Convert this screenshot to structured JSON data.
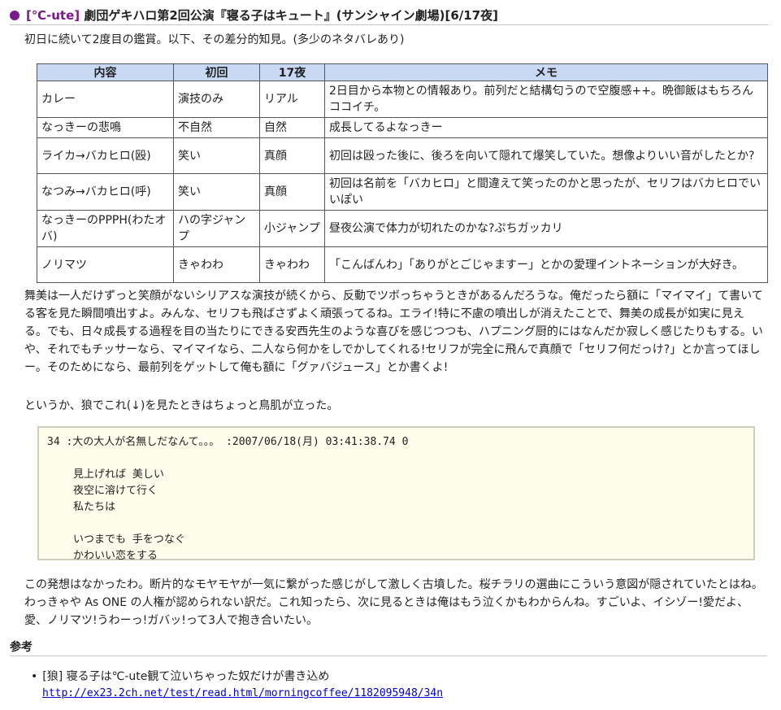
{
  "entry": {
    "category": "[℃-ute]",
    "title": "劇団ゲキハロ第2回公演『寝る子はキュート』(サンシャイン劇場)[6/17夜]"
  },
  "intro": "初日に続いて2度目の鑑賞。以下、その差分的知見。(多少のネタバレあり)",
  "table": {
    "headers": [
      "内容",
      "初回",
      "17夜",
      "メモ"
    ],
    "rows": [
      [
        "カレー",
        "演技のみ",
        "リアル",
        "2日目から本物との情報あり。前列だと結構匂うので空腹感++。晩御飯はもちろんココイチ。"
      ],
      [
        "なっきーの悲鳴",
        "不自然",
        "自然",
        "成長してるよなっきー"
      ],
      [
        "ライカ→バカヒロ(殴)",
        "笑い",
        "真顔",
        "初回は殴った後に、後ろを向いて隠れて爆笑していた。想像よりいい音がしたとか?"
      ],
      [
        "なつみ→バカヒロ(呼)",
        "笑い",
        "真顔",
        "初回は名前を「バカヒロ」と間違えて笑ったのかと思ったが、セリフはバカヒロでいいぽい"
      ],
      [
        "なっきーのPPPH(わたオバ)",
        "ハの字ジャンプ",
        "小ジャンプ",
        "昼夜公演で体力が切れたのかな?ぷちガッカリ"
      ],
      [
        "ノリマツ",
        "きゃわわ",
        "きゃわわ",
        "「こんばんわ」「ありがとごじゃますー」とかの愛理イントネーションが大好き。"
      ]
    ]
  },
  "paragraph1": "舞美は一人だけずっと笑顔がないシリアスな演技が続くから、反動でツボっちゃうときがあるんだろうな。俺だったら額に「マイマイ」て書いてる客を見た瞬間噴出すよ。みんな、セリフも飛ばさずよく頑張ってるね。エライ!特に不慮の噴出しが消えたことで、舞美の成長が如実に見える。でも、日々成長する過程を目の当たりにできる安西先生のような喜びを感じつつも、ハプニング厨的にはなんだか寂しく感じたりもする。いや、それでもチッサーなら、マイマイなら、二人なら何かをしでかしてくれる!セリフが完全に飛んで真顔で「セリフ何だっけ?」とか言ってほしー。そのためになら、最前列をゲットして俺も額に「グァバジュース」とか書くよ!",
  "paragraph2": "というか、狼でこれ(↓)を見たときはちょっと鳥肌が立った。",
  "quote": {
    "header": "34 :大の大人が名無しだなんて。。。 :2007/06/18(月) 03:41:38.74 0",
    "verse1": [
      "見上げれば  美しい",
      "夜空に溶けて行く",
      "私たちは"
    ],
    "verse2": [
      "いつまでも  手をつなぐ",
      "かわいい恋をする"
    ]
  },
  "paragraph3": "この発想はなかったわ。断片的なモヤモヤが一気に繋がった感じがして激しく古墳した。桜チラリの選曲にこういう意図が隠されていたとはね。わっきゃや As ONE の人権が認められない訳だ。これ知ったら、次に見るときは俺はもう泣くかもわからんね。すごいよ、イシゾー!愛だよ、愛、ノリマツ!うわーっ!ガバッ!って3人で抱き合いたい。",
  "references": {
    "title": "参考",
    "items": [
      {
        "bullet": "•",
        "label": "[狼] 寝る子は℃-ute観て泣いちゃった奴だけが書き込め",
        "url": "http://ex23.2ch.net/test/read.html/morningcoffee/1182095948/34n"
      }
    ]
  }
}
